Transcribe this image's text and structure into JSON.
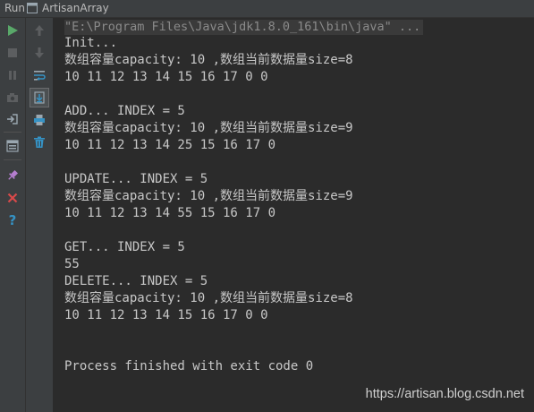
{
  "titlebar": {
    "run_label": "Run",
    "tab_label": "ArtisanArray"
  },
  "toolbar": {
    "left_icons": [
      "run-icon",
      "stop-icon",
      "pause-icon",
      "camera-icon",
      "login-icon",
      "layout-icon",
      "pin-icon",
      "close-icon",
      "help-icon"
    ],
    "mid_icons": [
      "arrow-up-icon",
      "arrow-down-icon",
      "soft-wrap-icon",
      "scroll-to-end-icon",
      "print-icon",
      "trash-icon"
    ],
    "colors": {
      "run": "#59a869",
      "close": "#d94a4a",
      "help": "#3592c4",
      "pin": "#b57ecf"
    }
  },
  "console": {
    "command": "\"E:\\Program Files\\Java\\jdk1.8.0_161\\bin\\java\" ...",
    "lines": [
      "Init...",
      "数组容量capacity: 10 ,数组当前数据量size=8",
      "10 11 12 13 14 15 16 17 0 0",
      "",
      "ADD... INDEX = 5",
      "数组容量capacity: 10 ,数组当前数据量size=9",
      "10 11 12 13 14 25 15 16 17 0",
      "",
      "UPDATE... INDEX = 5",
      "数组容量capacity: 10 ,数组当前数据量size=9",
      "10 11 12 13 14 55 15 16 17 0",
      "",
      "GET... INDEX = 5",
      "55",
      "DELETE... INDEX = 5",
      "数组容量capacity: 10 ,数组当前数据量size=8",
      "10 11 12 13 14 15 16 17 0 0",
      "",
      "",
      "Process finished with exit code 0"
    ]
  },
  "watermark": "https://artisan.blog.csdn.net"
}
